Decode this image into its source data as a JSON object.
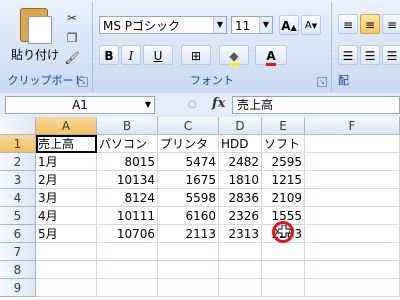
{
  "ribbon": {
    "clipboard": {
      "paste_label": "貼り付け",
      "group_label": "クリップボード"
    },
    "font": {
      "font_name": "MS Pゴシック",
      "font_size": "11",
      "grow_label": "A",
      "shrink_label": "A",
      "bold_label": "B",
      "italic_label": "I",
      "underline_label": "U",
      "font_color_label": "A",
      "group_label": "フォント"
    },
    "alignment": {
      "group_label": "配"
    }
  },
  "formula_bar": {
    "name_box": "A1",
    "fx_label": "fx",
    "value": "売上高"
  },
  "grid": {
    "columns": [
      "A",
      "B",
      "C",
      "D",
      "E",
      "F"
    ],
    "rows": [
      "1",
      "2",
      "3",
      "4",
      "5",
      "6",
      "7",
      "8",
      "9"
    ],
    "header_row": [
      "売上高",
      "パソコン",
      "プリンタ",
      "HDD",
      "ソフト"
    ],
    "data": [
      [
        "1月",
        "8015",
        "5474",
        "2482",
        "2595"
      ],
      [
        "2月",
        "10134",
        "1675",
        "1810",
        "1215"
      ],
      [
        "3月",
        "8124",
        "5598",
        "2836",
        "2109"
      ],
      [
        "4月",
        "10111",
        "6160",
        "2326",
        "1555"
      ],
      [
        "5月",
        "10706",
        "2113",
        "2313",
        "2283"
      ]
    ]
  },
  "colors": {
    "accent_red": "#e5101a",
    "selection": "#000000"
  }
}
